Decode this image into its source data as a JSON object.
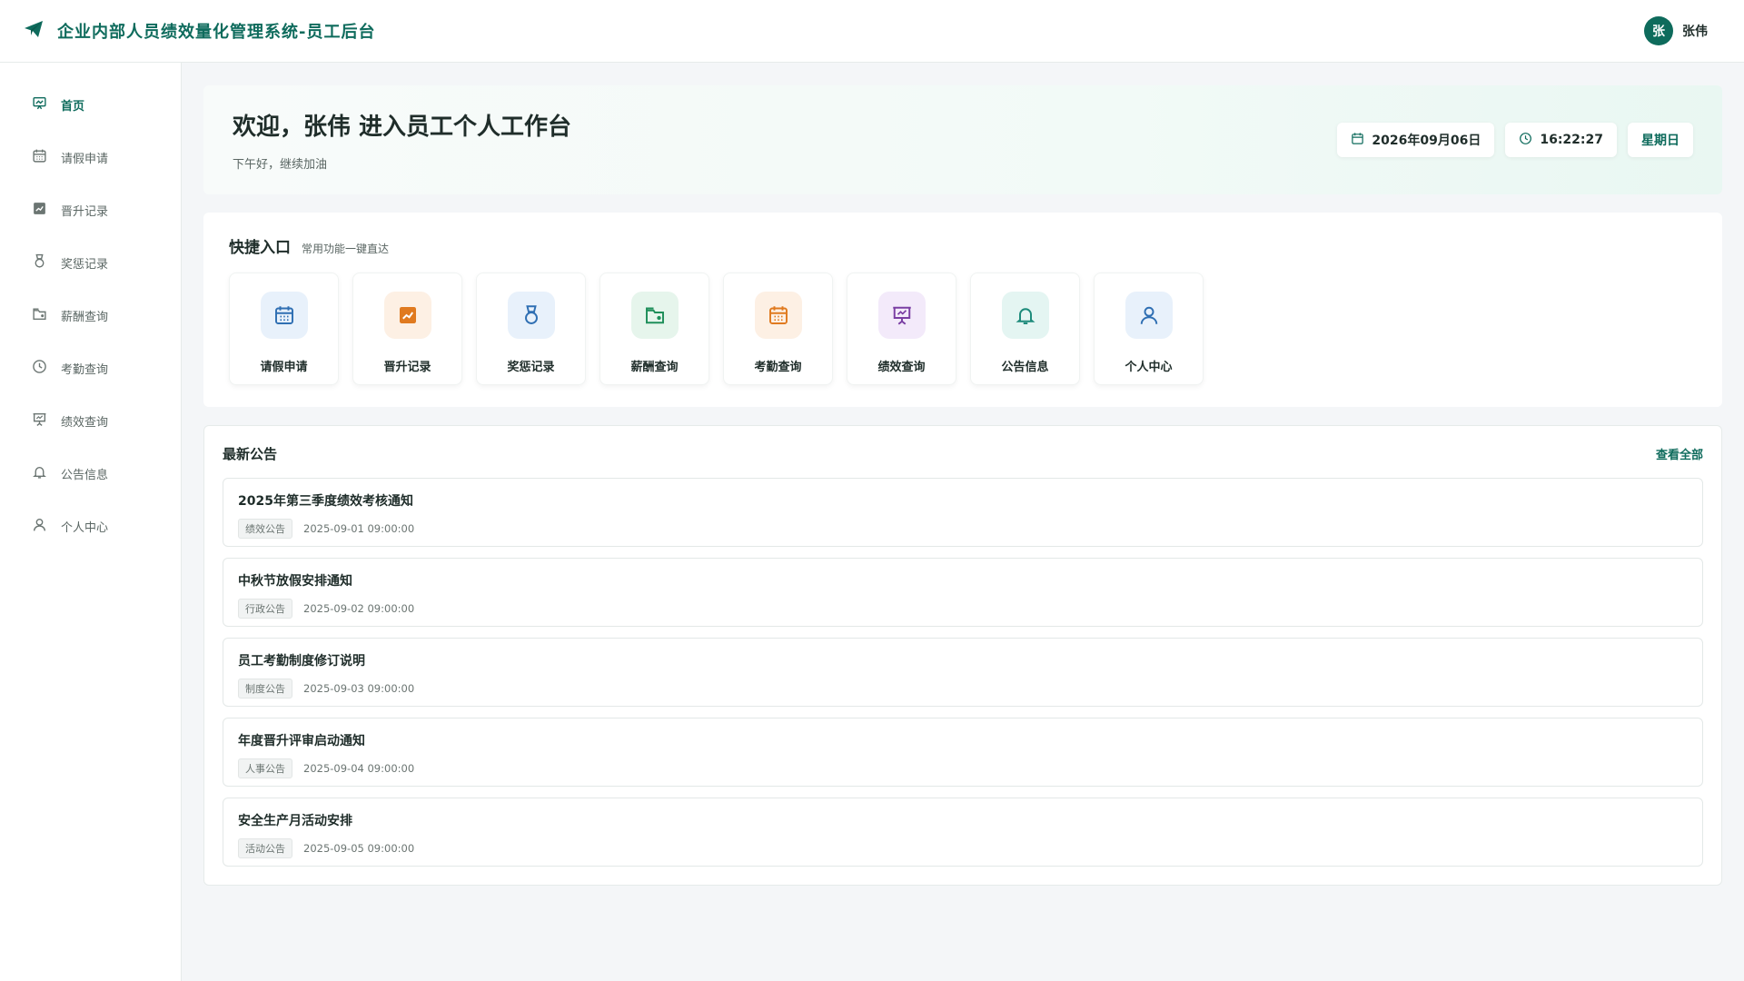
{
  "header": {
    "title": "企业内部人员绩效量化管理系统-员工后台",
    "user_initial": "张",
    "user_name": "张伟"
  },
  "sidebar": {
    "items": [
      {
        "label": "首页",
        "icon": "chart-board-icon",
        "active": true
      },
      {
        "label": "请假申请",
        "icon": "calendar-icon"
      },
      {
        "label": "晋升记录",
        "icon": "trend-chart-icon"
      },
      {
        "label": "奖惩记录",
        "icon": "medal-icon"
      },
      {
        "label": "薪酬查询",
        "icon": "wallet-icon"
      },
      {
        "label": "考勤查询",
        "icon": "clock-icon"
      },
      {
        "label": "绩效查询",
        "icon": "presentation-icon"
      },
      {
        "label": "公告信息",
        "icon": "bell-icon"
      },
      {
        "label": "个人中心",
        "icon": "user-icon"
      }
    ]
  },
  "welcome": {
    "title": "欢迎，张伟 进入员工个人工作台",
    "subtitle": "下午好，继续加油",
    "date": "2026年09月06日",
    "time": "16:22:27",
    "weekday": "星期日"
  },
  "quick": {
    "title": "快捷入口",
    "subtitle": "常用功能一键直达",
    "tiles": [
      {
        "label": "请假申请",
        "icon": "calendar-icon",
        "color": "#2f6fb3",
        "bg": "#e8f1fb"
      },
      {
        "label": "晋升记录",
        "icon": "trend-chart-icon",
        "color": "#e07a1f",
        "bg": "#fdf0e4"
      },
      {
        "label": "奖惩记录",
        "icon": "medal-icon",
        "color": "#2f6fb3",
        "bg": "#e8f1fb"
      },
      {
        "label": "薪酬查询",
        "icon": "wallet-icon",
        "color": "#1f8f5a",
        "bg": "#e6f5ec"
      },
      {
        "label": "考勤查询",
        "icon": "calendar-icon",
        "color": "#e07a1f",
        "bg": "#fdf0e4"
      },
      {
        "label": "绩效查询",
        "icon": "presentation-icon",
        "color": "#7a3ea3",
        "bg": "#f3eafa"
      },
      {
        "label": "公告信息",
        "icon": "bell-icon",
        "color": "#1c8a7a",
        "bg": "#e4f5f2"
      },
      {
        "label": "个人中心",
        "icon": "user-icon",
        "color": "#2f6fb3",
        "bg": "#e8f1fb"
      }
    ]
  },
  "notices": {
    "title": "最新公告",
    "view_all": "查看全部",
    "items": [
      {
        "title": "2025年第三季度绩效考核通知",
        "tag": "绩效公告",
        "time": "2025-09-01 09:00:00"
      },
      {
        "title": "中秋节放假安排通知",
        "tag": "行政公告",
        "time": "2025-09-02 09:00:00"
      },
      {
        "title": "员工考勤制度修订说明",
        "tag": "制度公告",
        "time": "2025-09-03 09:00:00"
      },
      {
        "title": "年度晋升评审启动通知",
        "tag": "人事公告",
        "time": "2025-09-04 09:00:00"
      },
      {
        "title": "安全生产月活动安排",
        "tag": "活动公告",
        "time": "2025-09-05 09:00:00"
      }
    ]
  },
  "colors": {
    "brand": "#0e6b5c",
    "nav_icon": "#6b7572"
  }
}
